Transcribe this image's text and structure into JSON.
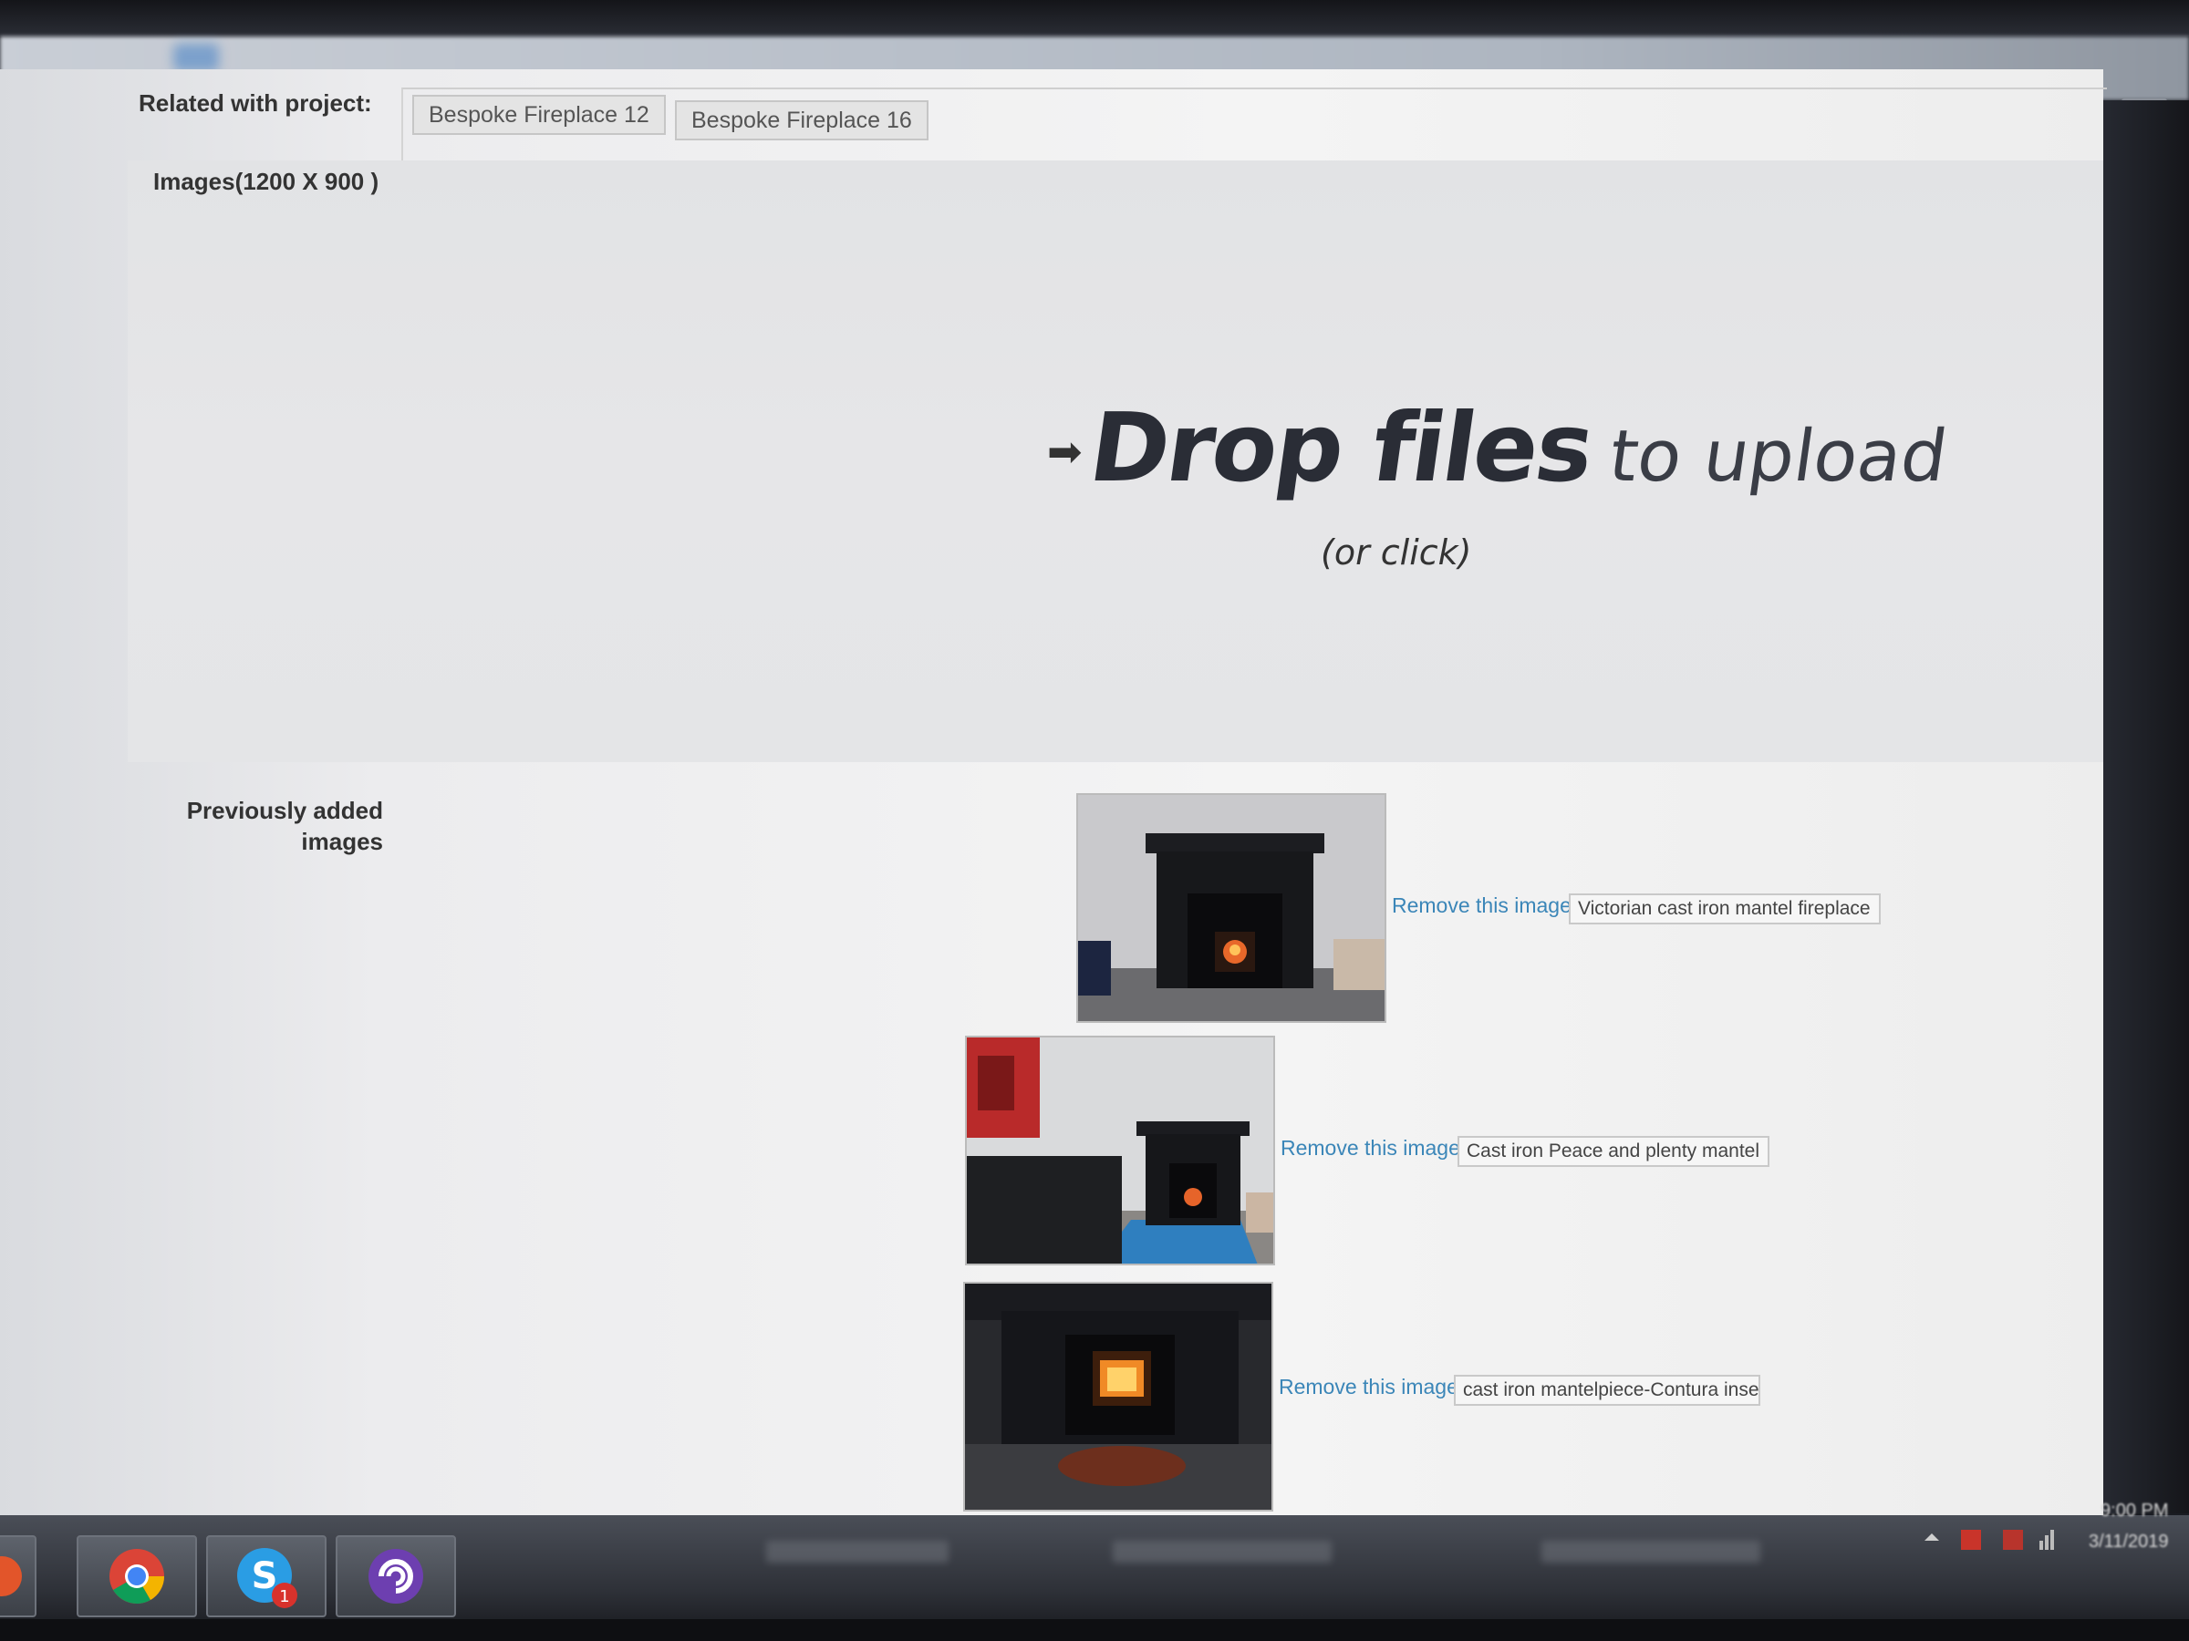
{
  "form": {
    "related_label": "Related with project:",
    "projects": [
      "Bespoke Fireplace 12",
      "Bespoke Fireplace 16"
    ],
    "images_label": "Images(1200 X 900 )"
  },
  "dropzone": {
    "arrow": "➡",
    "main_bold": "Drop files",
    "main_light": "to upload",
    "sub": "(or click)"
  },
  "previous": {
    "label_line1": "Previously added",
    "label_line2": "images",
    "items": [
      {
        "remove_label": "Remove this image",
        "caption": "Victorian cast iron mantel fireplace"
      },
      {
        "remove_label": "Remove this image",
        "caption": "Cast iron Peace and plenty mantel"
      },
      {
        "remove_label": "Remove this image",
        "caption": "cast iron mantelpiece-Contura inse"
      }
    ]
  },
  "taskbar": {
    "time": "9:00 PM",
    "date": "3/11/2019",
    "skype_badge": "1"
  }
}
